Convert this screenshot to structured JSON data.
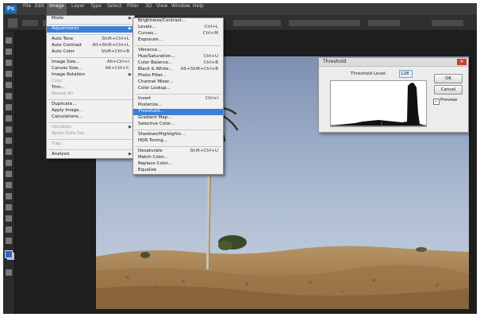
{
  "app": {
    "logo": "Ps"
  },
  "menubar": {
    "items": [
      {
        "label": "File"
      },
      {
        "label": "Edit"
      },
      {
        "label": "Image",
        "active": true
      },
      {
        "label": "Layer"
      },
      {
        "label": "Type"
      },
      {
        "label": "Select"
      },
      {
        "label": "Filter"
      },
      {
        "label": "3D"
      },
      {
        "label": "View"
      },
      {
        "label": "Window"
      },
      {
        "label": "Help"
      }
    ]
  },
  "image_menu": {
    "items": [
      {
        "label": "Mode",
        "arrow": true
      },
      {
        "separator": true
      },
      {
        "label": "Adjustments",
        "arrow": true,
        "highlighted": true
      },
      {
        "separator": true
      },
      {
        "label": "Auto Tone",
        "shortcut": "Shift+Ctrl+L"
      },
      {
        "label": "Auto Contrast",
        "shortcut": "Alt+Shift+Ctrl+L"
      },
      {
        "label": "Auto Color",
        "shortcut": "Shift+Ctrl+B"
      },
      {
        "separator": true
      },
      {
        "label": "Image Size...",
        "shortcut": "Alt+Ctrl+I"
      },
      {
        "label": "Canvas Size...",
        "shortcut": "Alt+Ctrl+C"
      },
      {
        "label": "Image Rotation",
        "arrow": true
      },
      {
        "label": "Crop",
        "disabled": true
      },
      {
        "label": "Trim..."
      },
      {
        "label": "Reveal All",
        "disabled": true
      },
      {
        "separator": true
      },
      {
        "label": "Duplicate..."
      },
      {
        "label": "Apply Image..."
      },
      {
        "label": "Calculations..."
      },
      {
        "separator": true
      },
      {
        "label": "Variables",
        "arrow": true,
        "disabled": true
      },
      {
        "label": "Apply Data Set...",
        "disabled": true
      },
      {
        "separator": true
      },
      {
        "label": "Trap...",
        "disabled": true
      },
      {
        "separator": true
      },
      {
        "label": "Analysis",
        "arrow": true
      }
    ]
  },
  "adjust_menu": {
    "items": [
      {
        "label": "Brightness/Contrast..."
      },
      {
        "label": "Levels...",
        "shortcut": "Ctrl+L"
      },
      {
        "label": "Curves...",
        "shortcut": "Ctrl+M"
      },
      {
        "label": "Exposure..."
      },
      {
        "separator": true
      },
      {
        "label": "Vibrance..."
      },
      {
        "label": "Hue/Saturation...",
        "shortcut": "Ctrl+U"
      },
      {
        "label": "Color Balance...",
        "shortcut": "Ctrl+B"
      },
      {
        "label": "Black & White...",
        "shortcut": "Alt+Shift+Ctrl+B"
      },
      {
        "label": "Photo Filter..."
      },
      {
        "label": "Channel Mixer..."
      },
      {
        "label": "Color Lookup..."
      },
      {
        "separator": true
      },
      {
        "label": "Invert",
        "shortcut": "Ctrl+I"
      },
      {
        "label": "Posterize..."
      },
      {
        "label": "Threshold...",
        "highlighted": true
      },
      {
        "label": "Gradient Map..."
      },
      {
        "label": "Selective Color..."
      },
      {
        "separator": true
      },
      {
        "label": "Shadows/Highlights..."
      },
      {
        "label": "HDR Toning..."
      },
      {
        "separator": true
      },
      {
        "label": "Desaturate",
        "shortcut": "Shift+Ctrl+U"
      },
      {
        "label": "Match Color..."
      },
      {
        "label": "Replace Color..."
      },
      {
        "label": "Equalize"
      }
    ]
  },
  "threshold_dialog": {
    "title": "Threshold",
    "level_label": "Threshold Level:",
    "level_value": "128",
    "ok_label": "OK",
    "cancel_label": "Cancel",
    "preview_label": "Preview",
    "preview_checked": true
  },
  "colors": {
    "menu_highlight": "#3d7fd6",
    "foreground": "#2e63c4"
  }
}
